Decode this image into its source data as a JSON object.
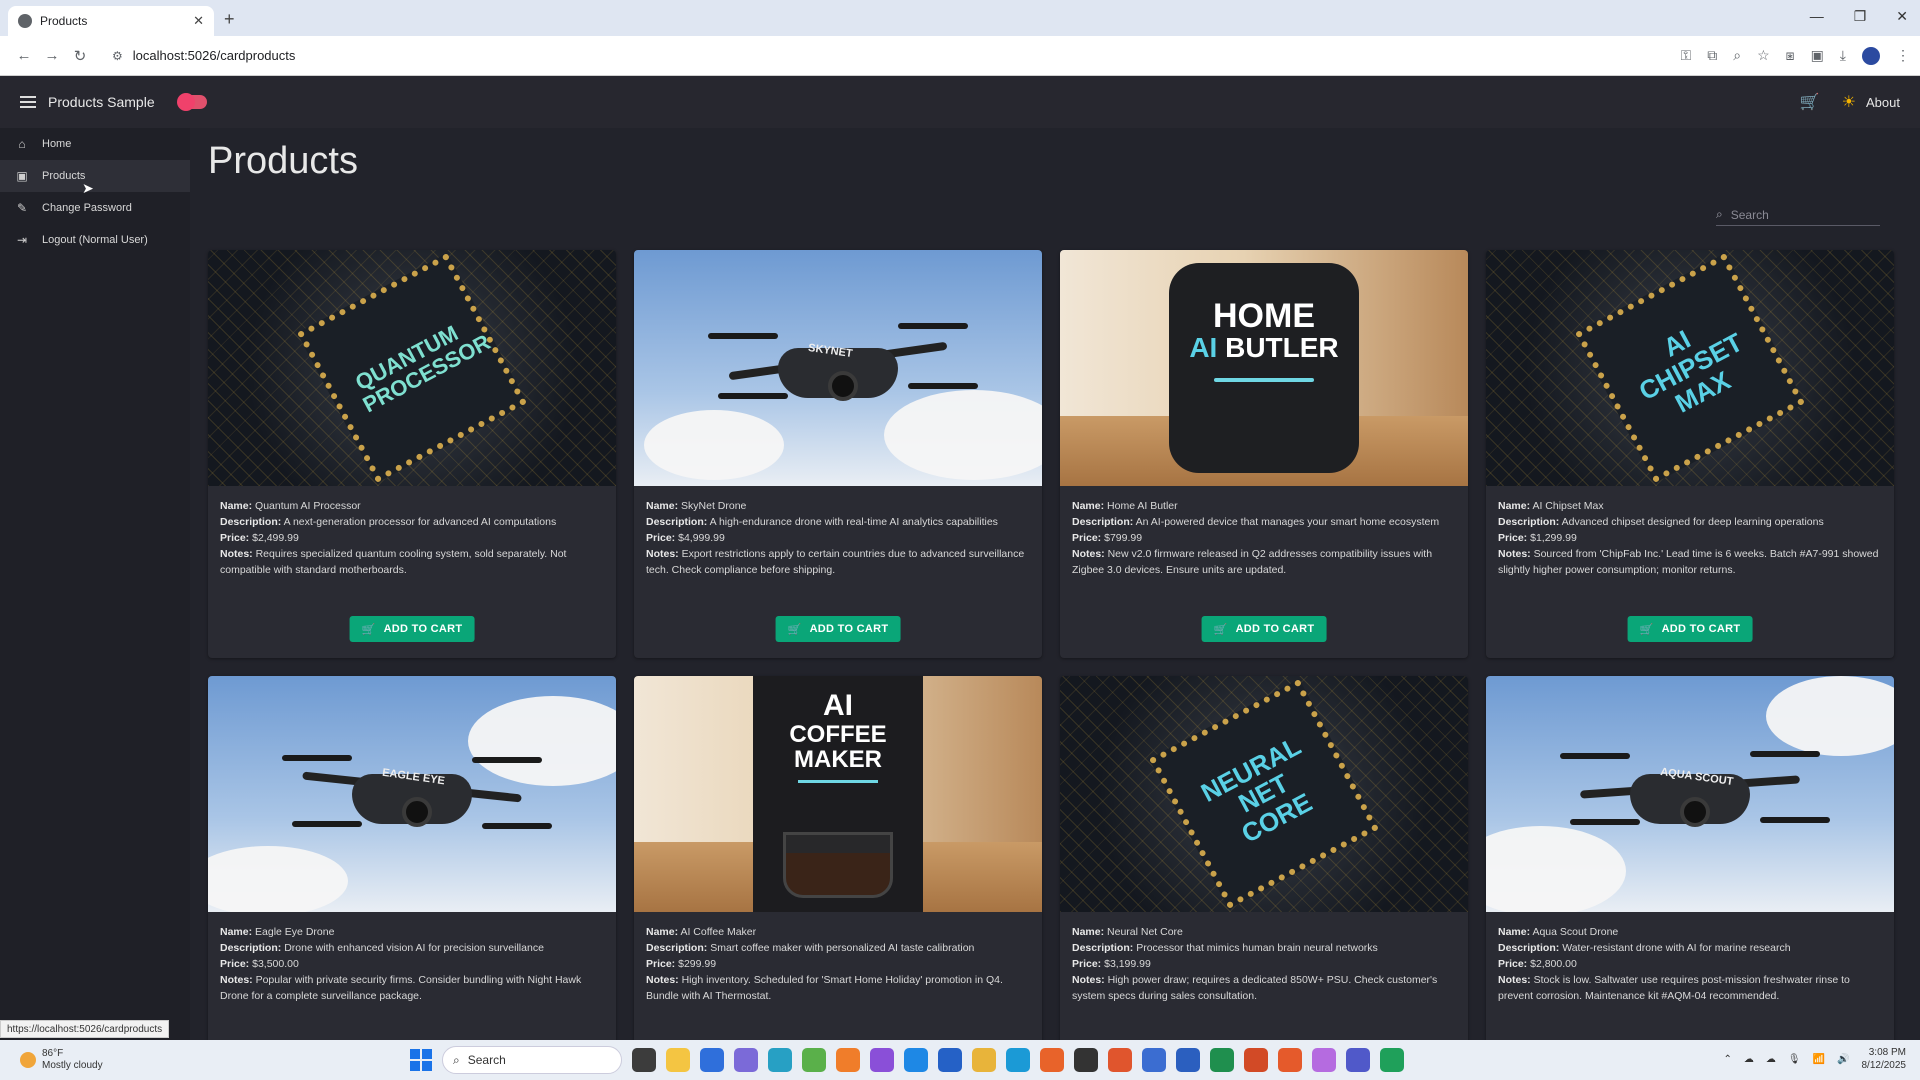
{
  "browser": {
    "tab_title": "Products",
    "url": "localhost:5026/cardproducts",
    "status_url": "https://localhost:5026/cardproducts"
  },
  "app": {
    "title": "Products Sample",
    "about_label": "About"
  },
  "sidebar": {
    "items": [
      {
        "label": "Home",
        "icon": "home-icon"
      },
      {
        "label": "Products",
        "icon": "shopping-bag-icon"
      },
      {
        "label": "Change Password",
        "icon": "pencil-icon"
      },
      {
        "label": "Logout (Normal User)",
        "icon": "logout-icon"
      }
    ]
  },
  "page": {
    "title": "Products",
    "search_placeholder": "Search"
  },
  "labels": {
    "name": "Name:",
    "description": "Description:",
    "price": "Price:",
    "notes": "Notes:",
    "add_to_cart": "ADD TO CART"
  },
  "products": [
    {
      "name": "Quantum AI Processor",
      "description": "A next-generation processor for advanced AI computations",
      "price": "$2,499.99",
      "notes": "Requires specialized quantum cooling system, sold separately. Not compatible with standard motherboards.",
      "image_text": "QUANTUM PROCESSOR"
    },
    {
      "name": "SkyNet Drone",
      "description": "A high-endurance drone with real-time AI analytics capabilities",
      "price": "$4,999.99",
      "notes": "Export restrictions apply to certain countries due to advanced surveillance tech. Check compliance before shipping.",
      "image_text": "SKYNET"
    },
    {
      "name": "Home AI Butler",
      "description": "An AI-powered device that manages your smart home ecosystem",
      "price": "$799.99",
      "notes": "New v2.0 firmware released in Q2 addresses compatibility issues with Zigbee 3.0 devices. Ensure units are updated.",
      "image_text_1": "HOME",
      "image_text_2a": "AI",
      "image_text_2b": "BUTLER"
    },
    {
      "name": "AI Chipset Max",
      "description": "Advanced chipset designed for deep learning operations",
      "price": "$1,299.99",
      "notes": "Sourced from 'ChipFab Inc.' Lead time is 6 weeks. Batch #A7-991 showed slightly higher power consumption; monitor returns.",
      "image_text": "AI CHIPSET MAX"
    },
    {
      "name": "Eagle Eye Drone",
      "description": "Drone with enhanced vision AI for precision surveillance",
      "price": "$3,500.00",
      "notes": "Popular with private security firms. Consider bundling with Night Hawk Drone for a complete surveillance package.",
      "image_text": "EAGLE EYE"
    },
    {
      "name": "AI Coffee Maker",
      "description": "Smart coffee maker with personalized AI taste calibration",
      "price": "$299.99",
      "notes": "High inventory. Scheduled for 'Smart Home Holiday' promotion in Q4. Bundle with AI Thermostat.",
      "image_text_1": "AI",
      "image_text_2": "COFFEE",
      "image_text_3": "MAKER"
    },
    {
      "name": "Neural Net Core",
      "description": "Processor that mimics human brain neural networks",
      "price": "$3,199.99",
      "notes": "High power draw; requires a dedicated 850W+ PSU. Check customer's system specs during sales consultation.",
      "image_text": "NEURAL NET CORE"
    },
    {
      "name": "Aqua Scout Drone",
      "description": "Water-resistant drone with AI for marine research",
      "price": "$2,800.00",
      "notes": "Stock is low. Saltwater use requires post-mission freshwater rinse to prevent corrosion. Maintenance kit #AQM-04 recommended.",
      "image_text": "AQUA SCOUT"
    }
  ],
  "taskbar": {
    "temperature": "86°F",
    "weather": "Mostly cloudy",
    "search_placeholder": "Search",
    "time": "3:08 PM",
    "date": "8/12/2025"
  },
  "colors": {
    "accent_button": "#0aa678",
    "toggle": "#f0416b",
    "background": "#22232b"
  }
}
